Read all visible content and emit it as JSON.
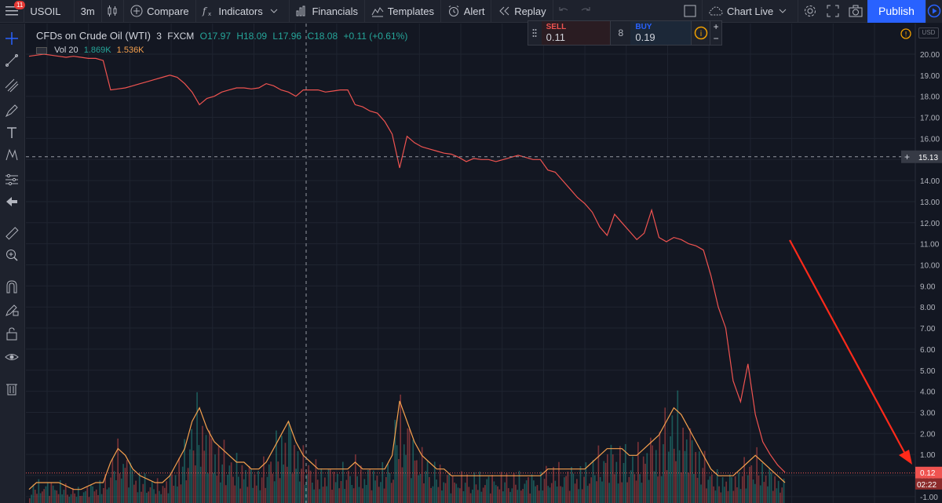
{
  "topbar": {
    "menu_badge": "11",
    "symbol": "USOIL",
    "interval": "3m",
    "compare": "Compare",
    "indicators": "Indicators",
    "financials": "Financials",
    "templates": "Templates",
    "alert": "Alert",
    "replay": "Replay",
    "chart_live": "Chart Live",
    "publish": "Publish"
  },
  "legend": {
    "symbol_name": "CFDs on Crude Oil (WTI)",
    "interval": "3",
    "exchange": "FXCM",
    "open": "O17.97",
    "high": "H18.09",
    "low": "L17.96",
    "close": "C18.08",
    "change": "+0.11 (+0.61%)"
  },
  "volume_legend": {
    "label": "Vol 20",
    "value": "1.869K",
    "ma": "1.536K"
  },
  "trade_panel": {
    "sell_label": "SELL",
    "sell_value": "0.11",
    "spread": "8",
    "buy_label": "BUY",
    "buy_value": "0.19"
  },
  "axis": {
    "currency": "USD",
    "crosshair_price": "15.13",
    "last_price": "0.12",
    "countdown": "02:22"
  },
  "colors": {
    "background": "#131722",
    "up": "#26a69a",
    "down": "#ef5350",
    "volume_ma": "#f6a04d",
    "annotation_arrow": "#ff2a1a",
    "accent": "#2962ff"
  },
  "chart_data": {
    "type": "line",
    "title": "CFDs on Crude Oil (WTI)",
    "ylim": [
      -1.0,
      20.5
    ],
    "ytick_labels": [
      "20.00",
      "19.00",
      "18.00",
      "17.00",
      "16.00",
      "15.00",
      "14.00",
      "13.00",
      "12.00",
      "11.00",
      "10.00",
      "9.00",
      "8.00",
      "7.00",
      "6.00",
      "5.00",
      "4.00",
      "3.00",
      "2.00",
      "1.00",
      "0.00",
      "-1.00"
    ],
    "yticks": [
      20,
      19,
      18,
      17,
      16,
      15,
      14,
      13,
      12,
      11,
      10,
      9,
      8,
      7,
      6,
      5,
      4,
      3,
      2,
      1,
      0,
      -1
    ],
    "grid": true,
    "series": [
      {
        "values": [
          19.9,
          19.95,
          20.0,
          19.95,
          19.9,
          19.85,
          19.9,
          19.85,
          19.8,
          19.8,
          19.7,
          18.3,
          18.35,
          18.4,
          18.5,
          18.6,
          18.7,
          18.8,
          18.9,
          19.0,
          18.9,
          18.6,
          18.2,
          17.6,
          17.9,
          18.0,
          18.2,
          18.3,
          18.4,
          18.4,
          18.35,
          18.4,
          18.6,
          18.5,
          18.3,
          18.2,
          18.0,
          18.3,
          18.3,
          18.3,
          18.2,
          18.25,
          18.3,
          18.3,
          17.6,
          17.5,
          17.3,
          17.2,
          16.8,
          16.2,
          14.6,
          16.1,
          15.8,
          15.6,
          15.5,
          15.4,
          15.3,
          15.25,
          15.1,
          14.9,
          15.05,
          15.0,
          15.0,
          14.9,
          15.0,
          15.1,
          15.2,
          15.1,
          15.0,
          15.0,
          14.5,
          14.4,
          14.0,
          13.6,
          13.2,
          12.9,
          12.5,
          11.8,
          11.4,
          12.4,
          12.0,
          11.6,
          11.2,
          11.5,
          12.6,
          11.3,
          11.1,
          11.3,
          11.2,
          11.0,
          10.9,
          10.7,
          9.5,
          8.0,
          7.0,
          4.5,
          3.5,
          5.3,
          2.9,
          1.6,
          1.0,
          0.5,
          0.15
        ]
      }
    ],
    "volume": {
      "label": "Vol 20",
      "values": [
        0.2,
        0.3,
        0.3,
        0.3,
        0.3,
        0.25,
        0.2,
        0.2,
        0.25,
        0.3,
        0.3,
        0.6,
        0.8,
        0.7,
        0.5,
        0.4,
        0.35,
        0.3,
        0.3,
        0.4,
        0.6,
        0.8,
        1.2,
        1.4,
        1.1,
        0.9,
        0.8,
        0.7,
        0.6,
        0.6,
        0.5,
        0.5,
        0.6,
        0.8,
        1.0,
        1.2,
        0.9,
        0.7,
        0.6,
        0.5,
        0.5,
        0.5,
        0.5,
        0.5,
        0.6,
        0.5,
        0.5,
        0.5,
        0.5,
        0.7,
        1.5,
        1.2,
        0.9,
        0.7,
        0.6,
        0.5,
        0.5,
        0.4,
        0.4,
        0.4,
        0.4,
        0.4,
        0.4,
        0.4,
        0.4,
        0.4,
        0.4,
        0.4,
        0.4,
        0.4,
        0.5,
        0.5,
        0.5,
        0.5,
        0.5,
        0.5,
        0.6,
        0.7,
        0.8,
        0.8,
        0.8,
        0.7,
        0.7,
        0.8,
        0.9,
        1.0,
        1.2,
        1.4,
        1.3,
        1.1,
        0.9,
        0.7,
        0.5,
        0.4,
        0.4,
        0.4,
        0.5,
        0.6,
        0.7,
        0.6,
        0.5,
        0.4,
        0.3
      ]
    }
  }
}
